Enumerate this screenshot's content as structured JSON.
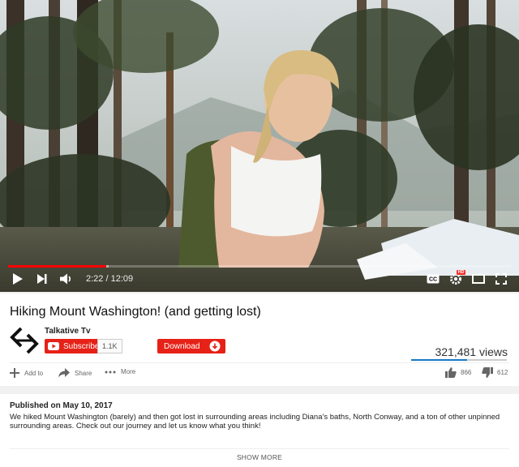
{
  "player": {
    "current_time": "2:22",
    "duration": "12:09",
    "time_display": "2:22 / 12:09",
    "progress_played": 0.195,
    "progress_loaded": 0.2,
    "quality_badge": "HD",
    "colors": {
      "progress": "#ff0000",
      "controls": "#ffffff"
    },
    "icons": [
      "play-icon",
      "next-icon",
      "volume-icon",
      "captions-icon",
      "settings-icon",
      "theater-mode-icon",
      "fullscreen-icon"
    ]
  },
  "video": {
    "title": "Hiking Mount Washington! (and getting lost)",
    "channel": {
      "name": "Talkative Tv",
      "subscribe_label": "Subscribe",
      "subscriber_count": "1.1K"
    },
    "download_label": "Download",
    "views": "321,481 views",
    "like_dislike_ratio": 0.586,
    "actions": {
      "add_to_label": "Add to",
      "share_label": "Share",
      "more_label": "More"
    },
    "likes": "866",
    "dislikes": "612",
    "colors": {
      "accent": "#e62117",
      "like_bar": "#167ac6"
    }
  },
  "description": {
    "published": "Published on May 10, 2017",
    "text": "We hiked Mount Washington (barely) and then got lost in surrounding areas including Diana's baths, North Conway, and a ton of other unpinned surrounding areas. Check out our journey and let us know what you think!",
    "show_more_label": "SHOW MORE"
  }
}
